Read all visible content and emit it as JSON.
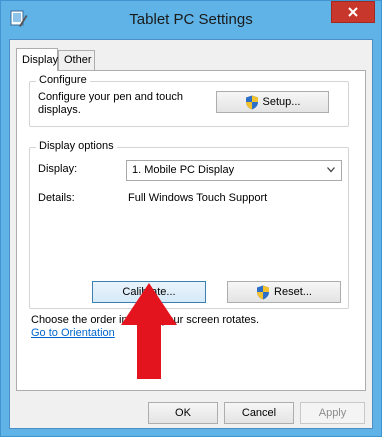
{
  "window": {
    "title": "Tablet PC Settings",
    "colors": {
      "frame": "#5fb3e6",
      "close": "#c7372b",
      "link": "#0066cc",
      "arrow": "#e3141e"
    }
  },
  "tabs": [
    {
      "label": "Display",
      "active": true
    },
    {
      "label": "Other",
      "active": false
    }
  ],
  "configure": {
    "legend": "Configure",
    "description": "Configure your pen and touch displays.",
    "setup_label": "Setup...",
    "setup_icon": "uac-shield-icon"
  },
  "display_options": {
    "legend": "Display options",
    "display_label": "Display:",
    "display_value": "1. Mobile PC Display",
    "details_label": "Details:",
    "details_value": "Full Windows Touch Support",
    "calibrate_label": "Calibrate...",
    "reset_label": "Reset...",
    "reset_icon": "uac-shield-icon"
  },
  "orientation": {
    "text": "Choose the order in which your screen rotates.",
    "link": "Go to Orientation"
  },
  "footer": {
    "ok_label": "OK",
    "cancel_label": "Cancel",
    "apply_label": "Apply"
  }
}
